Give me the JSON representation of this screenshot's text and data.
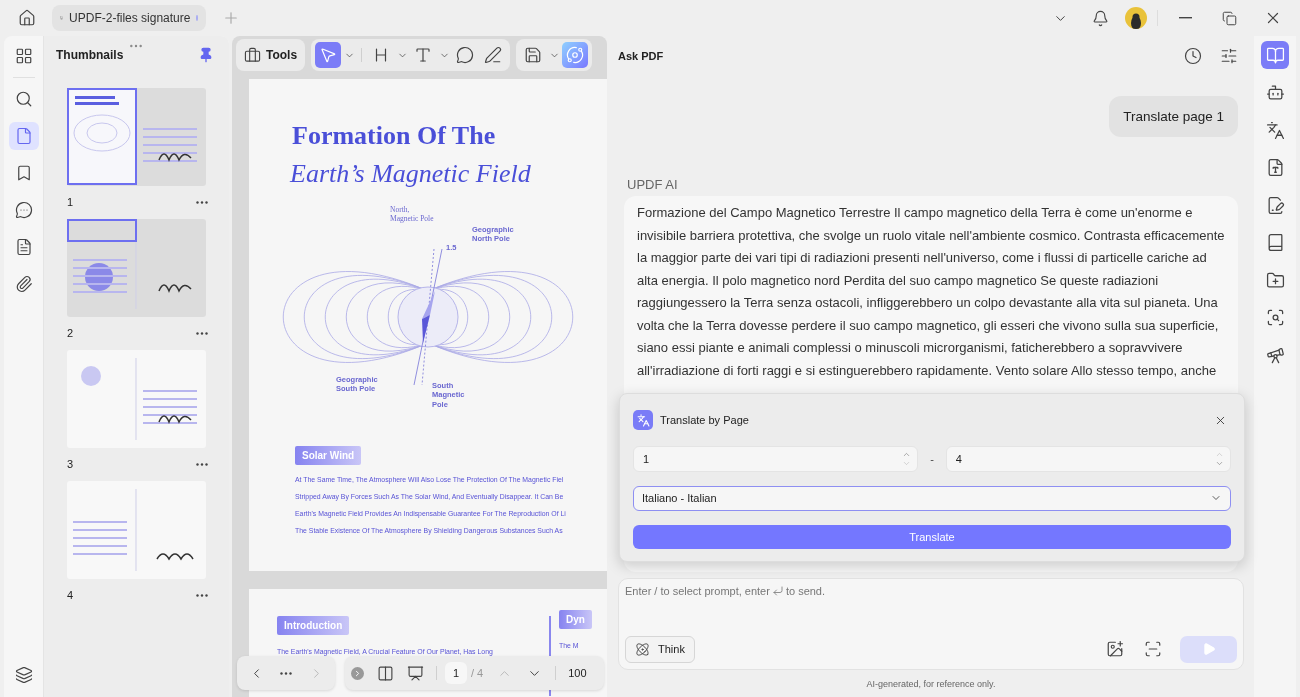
{
  "tabbar": {
    "tab": {
      "title": "UPDF-2-files signature",
      "unsaved": true
    }
  },
  "left_rail": {
    "items": [
      {
        "kind": "apps",
        "selected": false
      },
      {
        "kind": "search",
        "selected": false
      },
      {
        "kind": "pages",
        "selected": true
      },
      {
        "kind": "bookmarks",
        "selected": false
      },
      {
        "kind": "comments",
        "selected": false
      },
      {
        "kind": "forms",
        "selected": false
      },
      {
        "kind": "attachments",
        "selected": false
      }
    ],
    "bottom": [
      {
        "kind": "layers",
        "selected": false
      }
    ]
  },
  "thumbnails": {
    "title": "Thumbnails",
    "pinned": true,
    "pages": [
      {
        "label": "1",
        "in_view": true
      },
      {
        "label": "2",
        "in_view": true
      },
      {
        "label": "3",
        "in_view": false
      },
      {
        "label": "4",
        "in_view": false
      }
    ]
  },
  "doc_toolbar": {
    "tools": "Tools",
    "edit_tools": [
      {
        "kind": "select",
        "selected": true,
        "menu": true
      },
      {
        "kind": "heading",
        "selected": false,
        "menu": true
      },
      {
        "kind": "text",
        "selected": false,
        "menu": true
      },
      {
        "kind": "comment",
        "selected": false,
        "menu": false
      },
      {
        "kind": "pen",
        "selected": false,
        "menu": false
      }
    ],
    "extra_tools": [
      {
        "kind": "save",
        "selected": false,
        "menu": true
      },
      {
        "kind": "ai",
        "selected": true,
        "menu": false
      }
    ]
  },
  "document": {
    "page1": {
      "title": "Formation Of The",
      "subtitle": "Earth’s Magnetic Field",
      "diagram_labels": [
        {
          "lines": [
            "North,",
            "Magnetic Pole"
          ]
        },
        {
          "lines": [
            "Geographic",
            "North Pole"
          ]
        },
        {
          "lines": [
            "1.5"
          ]
        },
        {
          "lines": [
            "Geographic",
            "South Pole"
          ]
        },
        {
          "lines": [
            "South",
            "Magnetic",
            "Pole"
          ]
        }
      ],
      "section": "Solar Wind",
      "lines": [
        "At The Same Time, The Atmosphere Will Also Lose The Protection Of The Magnetic Fiel",
        "Stripped Away By Forces Such As The Solar Wind, And Eventually Disappear. It Can Be",
        "Earth's Magnetic Field Provides An Indispensable Guarantee For The Reproduction Of Li",
        "The Stable Existence Of The Atmosphere By Shielding Dangerous Substances Such As"
      ]
    },
    "page2": {
      "section": "Introduction",
      "line": "The Earth's Magnetic Field, A Crucial Feature Of Our Planet, Has Long",
      "side_section": "Dyn",
      "side_line": "The M"
    }
  },
  "page_nav": {
    "prev_disabled": false,
    "next_disabled": true,
    "page": "1",
    "total": "/ 4",
    "zoom": "100"
  },
  "ask_pdf": {
    "title": "Ask PDF",
    "user_message": "Translate page 1",
    "assistant_name": "UPDF AI",
    "assistant_message": "Formazione del Campo Magnetico Terrestre Il campo magnetico della Terra è come un'enorme e invisibile barriera protettiva, che svolge un ruolo vitale nell'ambiente cosmico. Contrasta efficacemente la maggior parte dei vari tipi di radiazioni presenti nell'universo, come i flussi di particelle cariche ad alta energia. Il polo magnetico nord Perdita del suo campo magnetico Se queste radiazioni raggiungessero la Terra senza ostacoli, infliggerebbero un colpo devastante alla vita sul pianeta. Una volta che la Terra dovesse perdere il suo campo magnetico, gli esseri che vivono sulla sua superficie, siano essi piante e animali complessi o minuscoli microrganismi, faticherebbero a sopravvivere all'irradiazione di forti raggi e si estinguerebbero rapidamente. Vento solare Allo stesso tempo, anche",
    "prompt_hint_start": "Enter / to select prompt, enter",
    "prompt_hint_end": "to send.",
    "think": "Think",
    "think_on": false,
    "send_disabled": true,
    "footer": "AI-generated, for reference only."
  },
  "dialog": {
    "title": "Translate by Page",
    "from": "1",
    "separator": "-",
    "to": "4",
    "language": "Italiano - Italian",
    "action": "Translate"
  },
  "right_rail": {
    "items": [
      {
        "kind": "ask",
        "selected": true
      },
      {
        "kind": "chat",
        "selected": false
      },
      {
        "kind": "translate",
        "selected": false
      },
      {
        "kind": "translate-page",
        "selected": false
      },
      {
        "kind": "summarize",
        "selected": false
      },
      {
        "kind": "book",
        "selected": false
      },
      {
        "kind": "folder",
        "selected": false
      },
      {
        "kind": "search",
        "selected": false
      },
      {
        "kind": "telescope",
        "selected": false
      }
    ]
  }
}
